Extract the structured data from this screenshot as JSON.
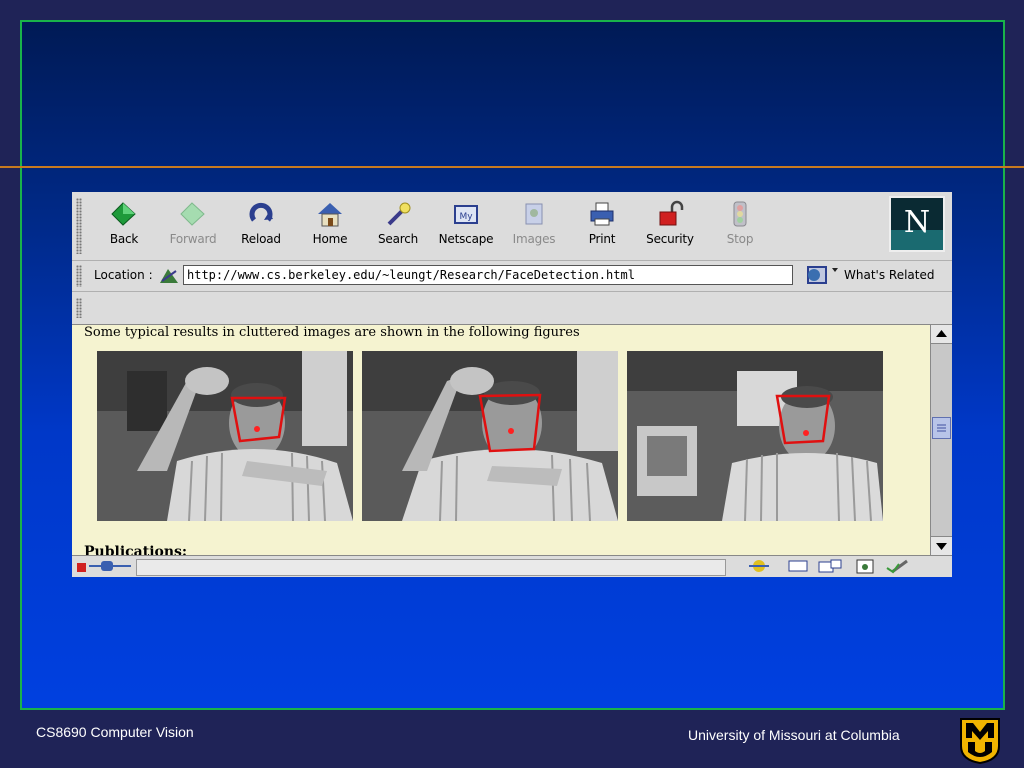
{
  "browser": {
    "toolbar": [
      {
        "id": "back",
        "label": "Back",
        "icon": "back-arrow-icon",
        "enabled": true
      },
      {
        "id": "forward",
        "label": "Forward",
        "icon": "forward-arrow-icon",
        "enabled": false
      },
      {
        "id": "reload",
        "label": "Reload",
        "icon": "reload-icon",
        "enabled": true
      },
      {
        "id": "home",
        "label": "Home",
        "icon": "home-icon",
        "enabled": true
      },
      {
        "id": "search",
        "label": "Search",
        "icon": "search-icon",
        "enabled": true
      },
      {
        "id": "netscape",
        "label": "Netscape",
        "icon": "netscape-icon",
        "enabled": true
      },
      {
        "id": "images",
        "label": "Images",
        "icon": "images-icon",
        "enabled": false
      },
      {
        "id": "print",
        "label": "Print",
        "icon": "print-icon",
        "enabled": true
      },
      {
        "id": "security",
        "label": "Security",
        "icon": "security-lock-icon",
        "enabled": true
      },
      {
        "id": "stop",
        "label": "Stop",
        "icon": "stop-icon",
        "enabled": false
      }
    ],
    "location": {
      "label": "Location :",
      "url": "http://www.cs.berkeley.edu/~leungt/Research/FaceDetection.html"
    },
    "whats_related": "What's Related",
    "content": {
      "intro": "Some typical results in cluttered images are shown in the following figures",
      "partial_heading": "Publications:"
    }
  },
  "footer": {
    "course": "CS8690 Computer Vision",
    "university": "University of Missouri at Columbia"
  },
  "colors": {
    "frame_border": "#19b34a",
    "title_rule": "#c87a1f",
    "face_box": "#e01010"
  }
}
